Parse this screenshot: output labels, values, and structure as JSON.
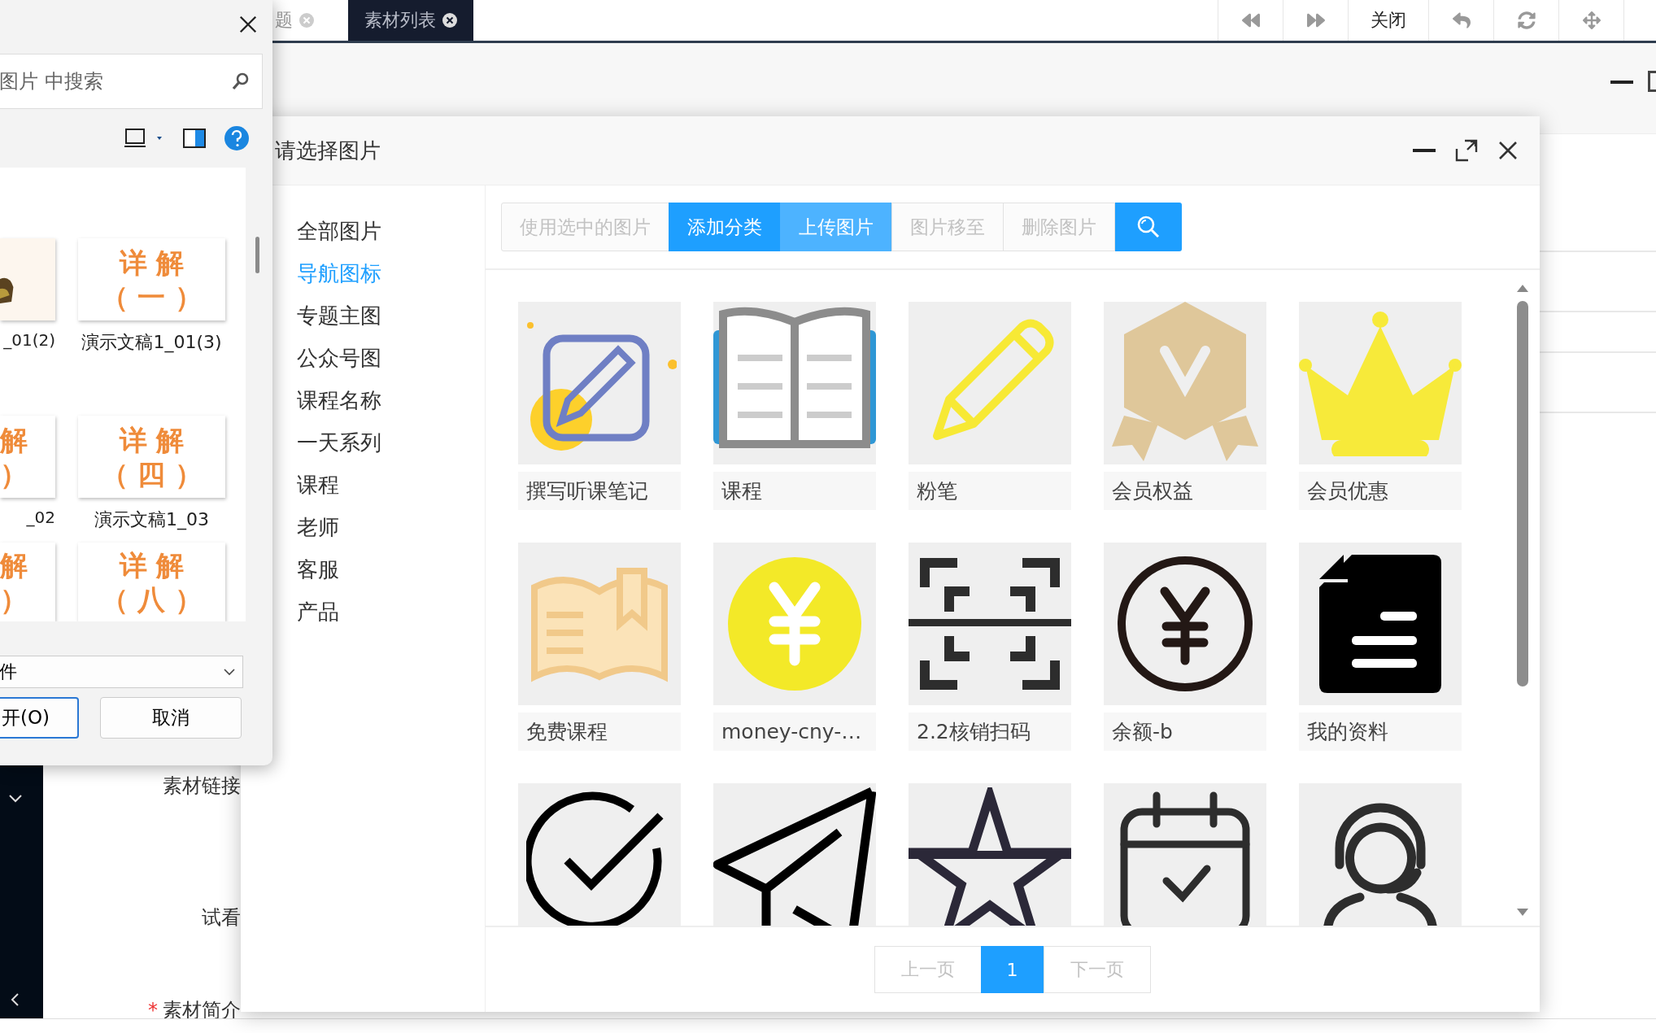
{
  "app_tabs": [
    {
      "label": "题",
      "selected": false
    },
    {
      "label": "素材列表",
      "selected": true
    }
  ],
  "app_toolbar": {
    "close_label": "关闭"
  },
  "form_labels": [
    {
      "label": "素材链接"
    },
    {
      "label": "试看"
    },
    {
      "label": "素材简介",
      "required_mark": "*"
    }
  ],
  "picker": {
    "title": "请选择图片",
    "categories": [
      {
        "label": "全部图片",
        "selected": false
      },
      {
        "label": "导航图标",
        "selected": true
      },
      {
        "label": "专题主图",
        "selected": false
      },
      {
        "label": "公众号图",
        "selected": false
      },
      {
        "label": "课程名称",
        "selected": false
      },
      {
        "label": "一天系列",
        "selected": false
      },
      {
        "label": "课程",
        "selected": false
      },
      {
        "label": "老师",
        "selected": false
      },
      {
        "label": "客服",
        "selected": false
      },
      {
        "label": "产品",
        "selected": false
      }
    ],
    "actions": [
      {
        "label": "使用选中的图片",
        "kind": "disabled"
      },
      {
        "label": "添加分类",
        "kind": "primary"
      },
      {
        "label": "上传图片",
        "kind": "light"
      },
      {
        "label": "图片移至",
        "kind": "disabled"
      },
      {
        "label": "删除图片",
        "kind": "disabled"
      }
    ],
    "images": [
      {
        "kind": "icon",
        "label": "撰写听课笔记"
      },
      {
        "kind": "icon",
        "label": "课程"
      },
      {
        "kind": "icon",
        "label": "粉笔"
      },
      {
        "kind": "icon",
        "label": "会员权益"
      },
      {
        "kind": "icon",
        "label": "会员优惠"
      },
      {
        "kind": "icon",
        "label": "免费课程"
      },
      {
        "kind": "icon",
        "label": "money-cny-…"
      },
      {
        "kind": "icon",
        "label": "2.2核销扫码"
      },
      {
        "kind": "icon",
        "label": "余额-b"
      },
      {
        "kind": "icon",
        "label": "我的资料"
      },
      {
        "kind": "icon"
      },
      {
        "kind": "icon"
      },
      {
        "kind": "icon"
      },
      {
        "kind": "icon"
      },
      {
        "kind": "icon"
      }
    ],
    "pagination": {
      "prev": "上一页",
      "next": "下一页",
      "pages": [
        {
          "label": "1",
          "selected": true
        }
      ]
    }
  },
  "file_dialog": {
    "search_placeholder": "图片 中搜索",
    "files": [
      {
        "name": "_01(2)"
      },
      {
        "kind": "text",
        "lines": [
          "详 解",
          "（ 一 ）"
        ],
        "name": "演示文稿1_01(3)"
      },
      {
        "kind": "text",
        "lines": [
          "解",
          "）"
        ],
        "name": "_02"
      },
      {
        "kind": "text",
        "lines": [
          "详 解",
          "（ 四 ）"
        ],
        "name": "演示文稿1_03"
      },
      {
        "kind": "text",
        "lines": [
          "解",
          "）"
        ]
      },
      {
        "kind": "text",
        "lines": [
          "详 解",
          "（ 八 ）"
        ]
      }
    ],
    "file_type": "件",
    "open_button": "开(O)",
    "cancel_button": "取消"
  }
}
